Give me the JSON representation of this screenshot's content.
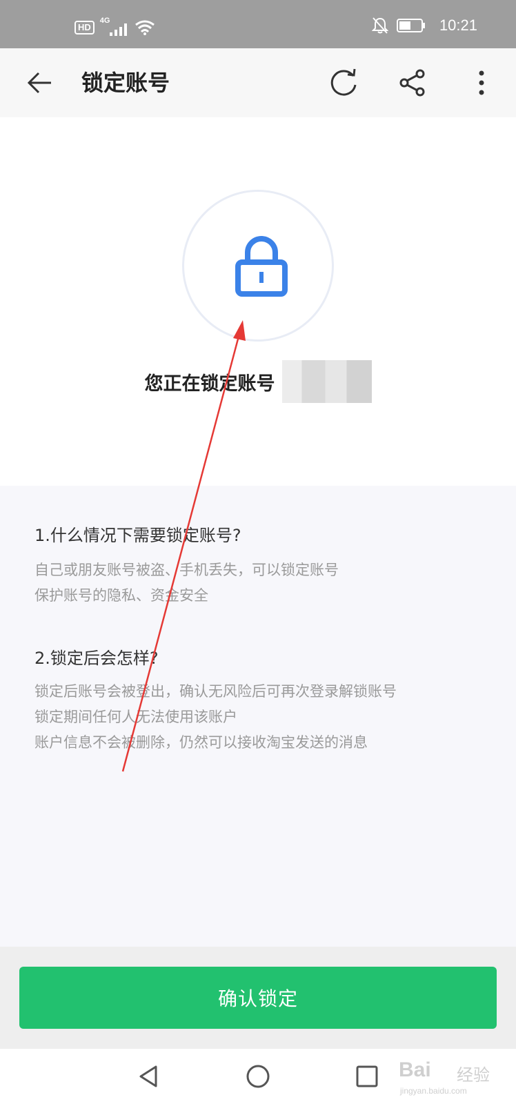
{
  "status_bar": {
    "hd": "HD",
    "network": "4G",
    "time": "10:21",
    "icons": [
      "signal-icon",
      "wifi-icon",
      "bell-muted-icon",
      "battery-icon"
    ]
  },
  "header": {
    "title": "锁定账号",
    "icons": [
      "back-arrow-icon",
      "refresh-icon",
      "share-icon",
      "more-icon"
    ]
  },
  "hero": {
    "lock_icon": "lock-icon",
    "locking_label": "您正在锁定账号"
  },
  "faq": [
    {
      "question": "1.什么情况下需要锁定账号?",
      "answer_lines": [
        "自己或朋友账号被盗、手机丢失，可以锁定账号",
        "保护账号的隐私、资金安全"
      ]
    },
    {
      "question": "2.锁定后会怎样?",
      "answer_lines": [
        "锁定后账号会被登出，确认无风险后可再次登录解锁账号",
        "锁定期间任何人无法使用该账户",
        "账户信息不会被删除，仍然可以接收淘宝发送的消息"
      ]
    }
  ],
  "confirm_button": {
    "label": "确认锁定"
  },
  "nav": {
    "icons": [
      "nav-back-icon",
      "nav-home-icon",
      "nav-recent-icon"
    ]
  },
  "watermark": {
    "brand": "Bai",
    "brand_cn": "经验",
    "site": "jingyan.baidu.com"
  },
  "colors": {
    "accent_green": "#22c16f",
    "lock_blue": "#3b82e8",
    "annotation_red": "#e53935"
  }
}
